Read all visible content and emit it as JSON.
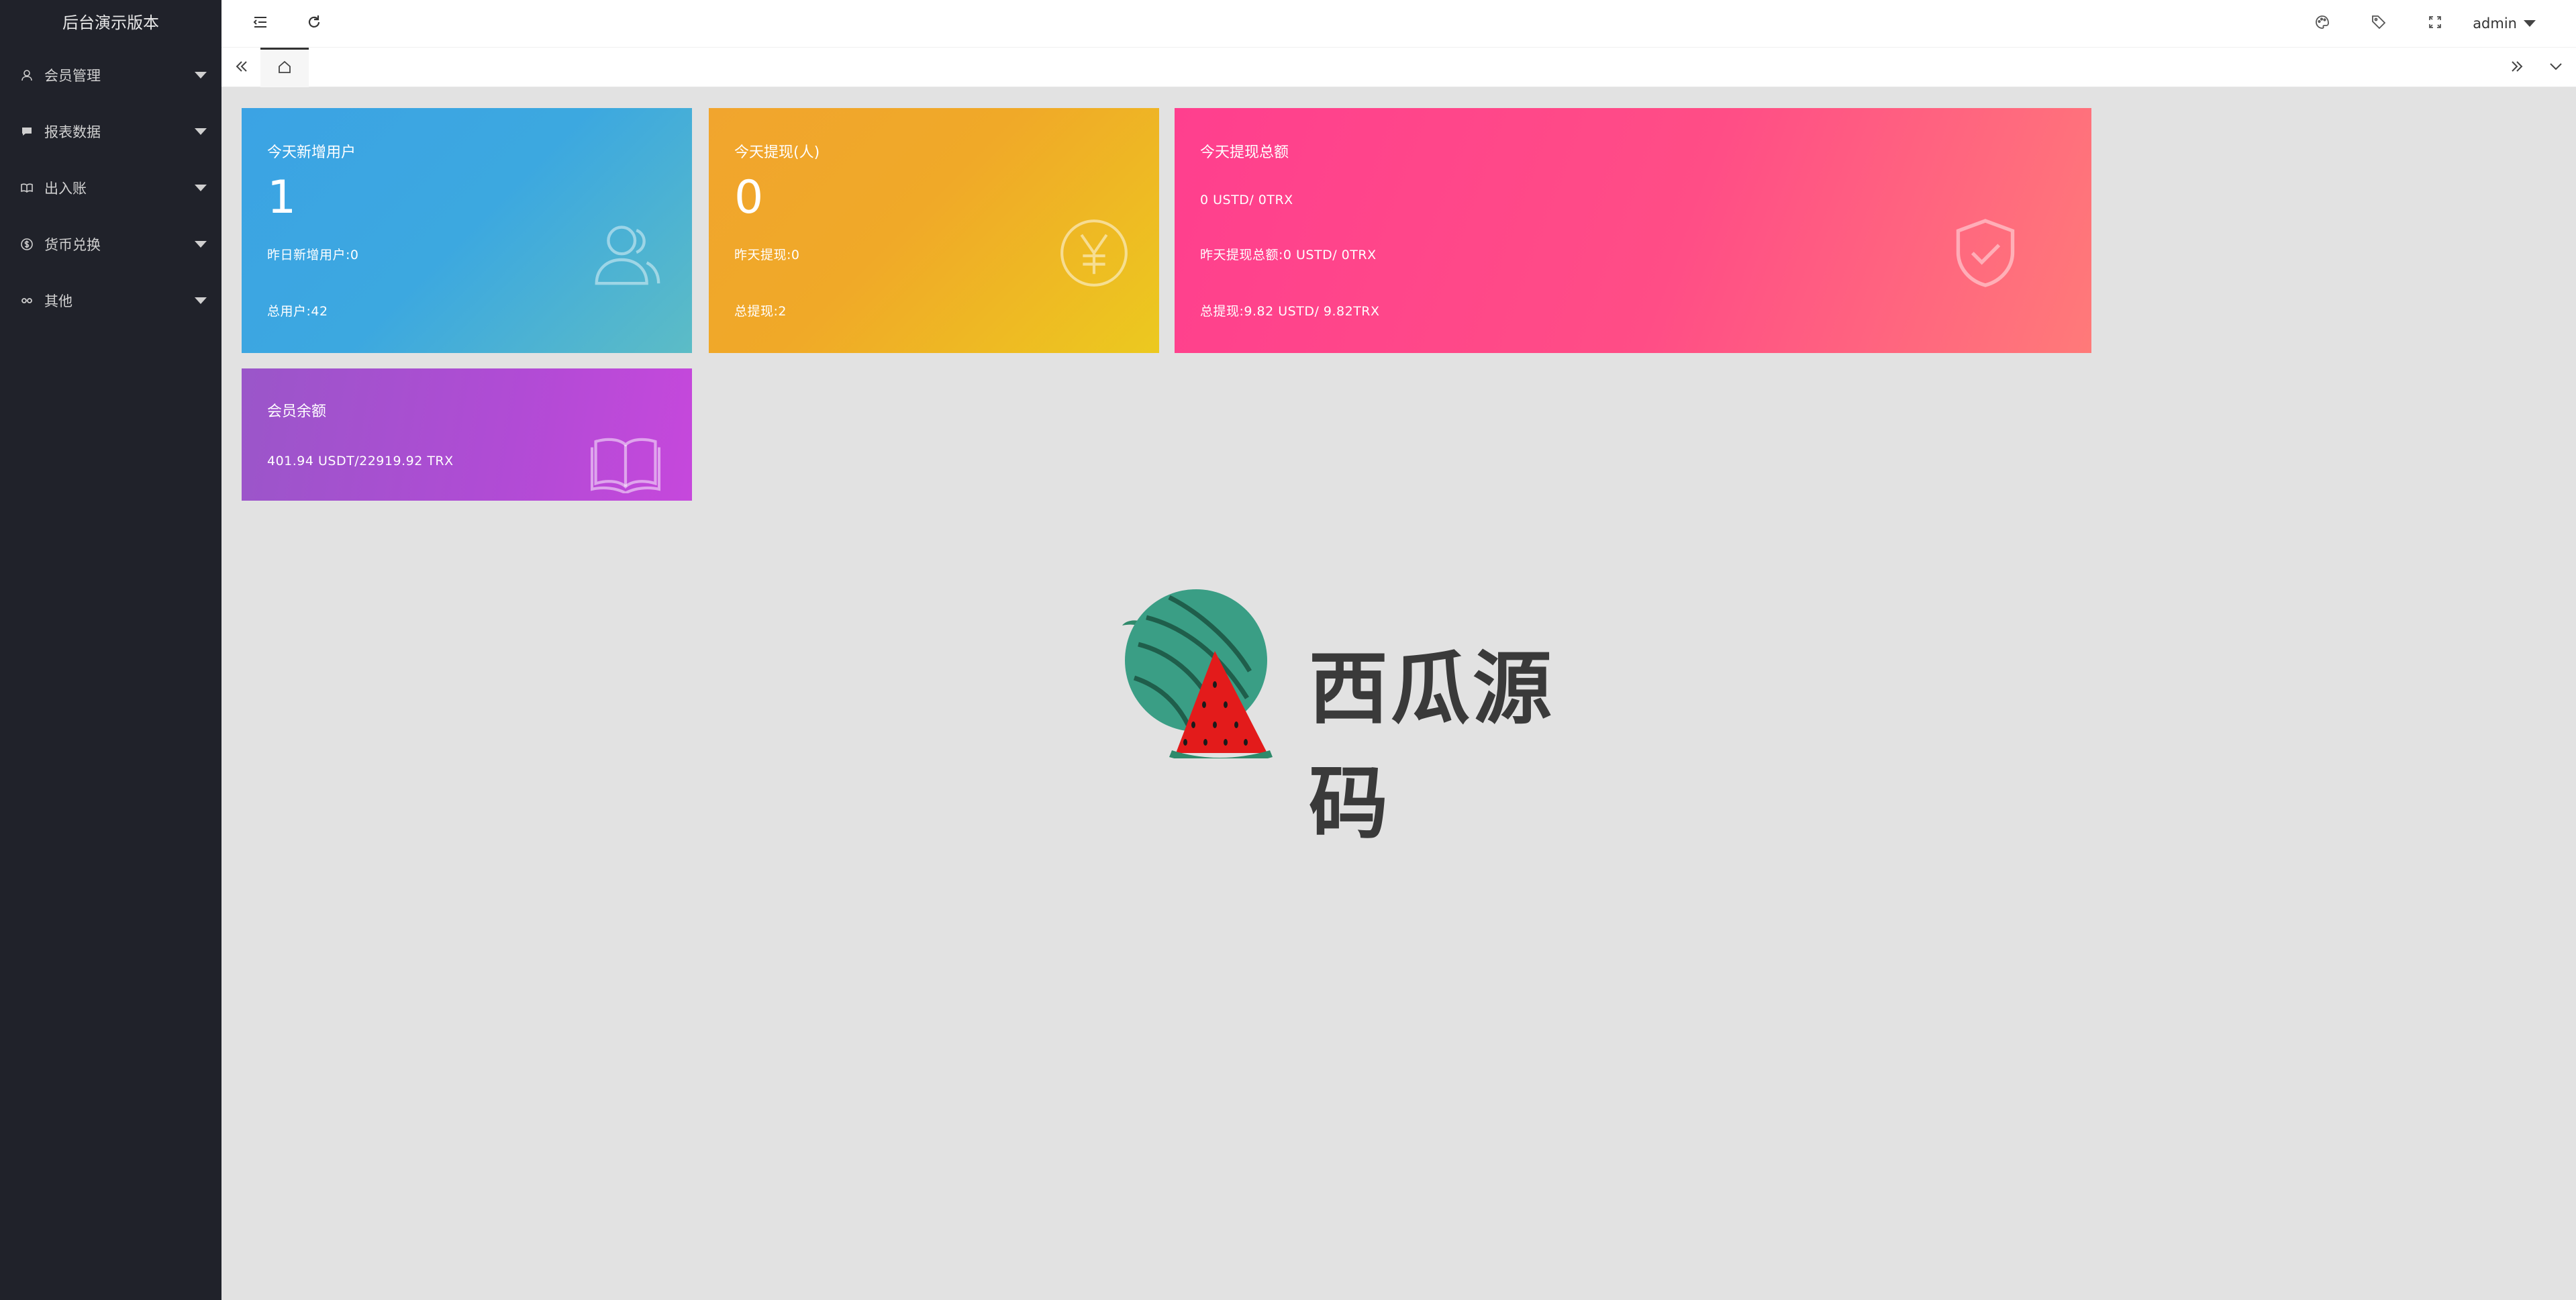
{
  "sidebar": {
    "brand": "后台演示版本",
    "items": [
      {
        "label": "会员管理",
        "icon": "user-icon"
      },
      {
        "label": "报表数据",
        "icon": "chat-icon"
      },
      {
        "label": "出入账",
        "icon": "book-icon"
      },
      {
        "label": "货币兑换",
        "icon": "dollar-icon"
      },
      {
        "label": "其他",
        "icon": "link-icon"
      }
    ]
  },
  "header": {
    "user": "admin",
    "icons": [
      "menu-fold-icon",
      "refresh-icon",
      "theme-icon",
      "tag-icon",
      "fullscreen-icon"
    ]
  },
  "tabs": {
    "home_icon": "home-icon"
  },
  "cards": {
    "new_users": {
      "title": "今天新增用户",
      "value": "1",
      "yesterday": "昨日新增用户:0",
      "total": "总用户:42"
    },
    "withdraw_people": {
      "title": "今天提现(人)",
      "value": "0",
      "yesterday": "昨天提现:0",
      "total": "总提现:2"
    },
    "withdraw_amount": {
      "title": "今天提现总额",
      "today": "0 USTD/ 0TRX",
      "yesterday": "昨天提现总额:0 USTD/ 0TRX",
      "total": "总提现:9.82 USTD/ 9.82TRX"
    },
    "balance": {
      "title": "会员余额",
      "value": "401.94 USDT/22919.92 TRX"
    }
  },
  "watermark": {
    "text": "西瓜源码"
  },
  "colors": {
    "sidebar_bg": "#20222a",
    "content_bg": "#e2e2e2",
    "card_blue": "#3ba3e4",
    "card_orange": "#f0a928",
    "card_pink": "#ff4d86",
    "card_purple": "#b14bd5"
  }
}
